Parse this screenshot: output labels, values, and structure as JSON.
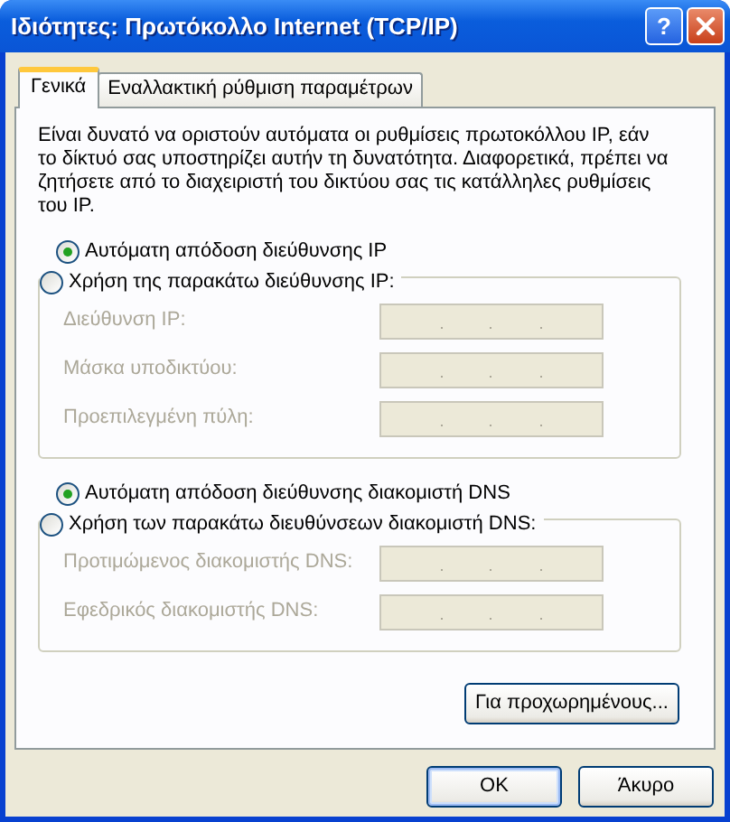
{
  "window": {
    "title": "Ιδιότητες: Πρωτόκολλο Internet (TCP/IP)",
    "help_button": "?"
  },
  "tabs": [
    {
      "label": "Γενικά",
      "selected": true
    },
    {
      "label": "Εναλλακτική ρύθμιση παραμέτρων",
      "selected": false
    }
  ],
  "description": "Είναι δυνατό να οριστούν αυτόματα οι ρυθμίσεις πρωτοκόλλου IP, εάν το δίκτυό σας υποστηρίζει αυτήν τη δυνατότητα. Διαφορετικά, πρέπει να ζητήσετε από το διαχειριστή του δικτύου σας τις κατάλληλες ρυθμίσεις του IP.",
  "ip_auto": {
    "label": "Αυτόματη απόδοση διεύθυνσης IP",
    "selected": true
  },
  "ip_manual": {
    "label": "Χρήση της παρακάτω διεύθυνσης IP:",
    "selected": false,
    "fields": [
      {
        "label": "Διεύθυνση IP:",
        "disabled": true
      },
      {
        "label": "Μάσκα υποδικτύου:",
        "disabled": true
      },
      {
        "label": "Προεπιλεγμένη πύλη:",
        "disabled": true
      }
    ]
  },
  "dns_auto": {
    "label": "Αυτόματη απόδοση διεύθυνσης διακομιστή DNS",
    "selected": true
  },
  "dns_manual": {
    "label": "Χρήση των παρακάτω διευθύνσεων διακομιστή DNS:",
    "selected": false,
    "fields": [
      {
        "label": "Προτιμώμενος διακομιστής DNS:",
        "disabled": true
      },
      {
        "label": "Εφεδρικός διακομιστής DNS:",
        "disabled": true
      }
    ]
  },
  "advanced_button": "Για προχωρημένους...",
  "buttons": [
    {
      "label": "OK",
      "default": true
    },
    {
      "label": "Άκυρο",
      "default": false
    }
  ]
}
